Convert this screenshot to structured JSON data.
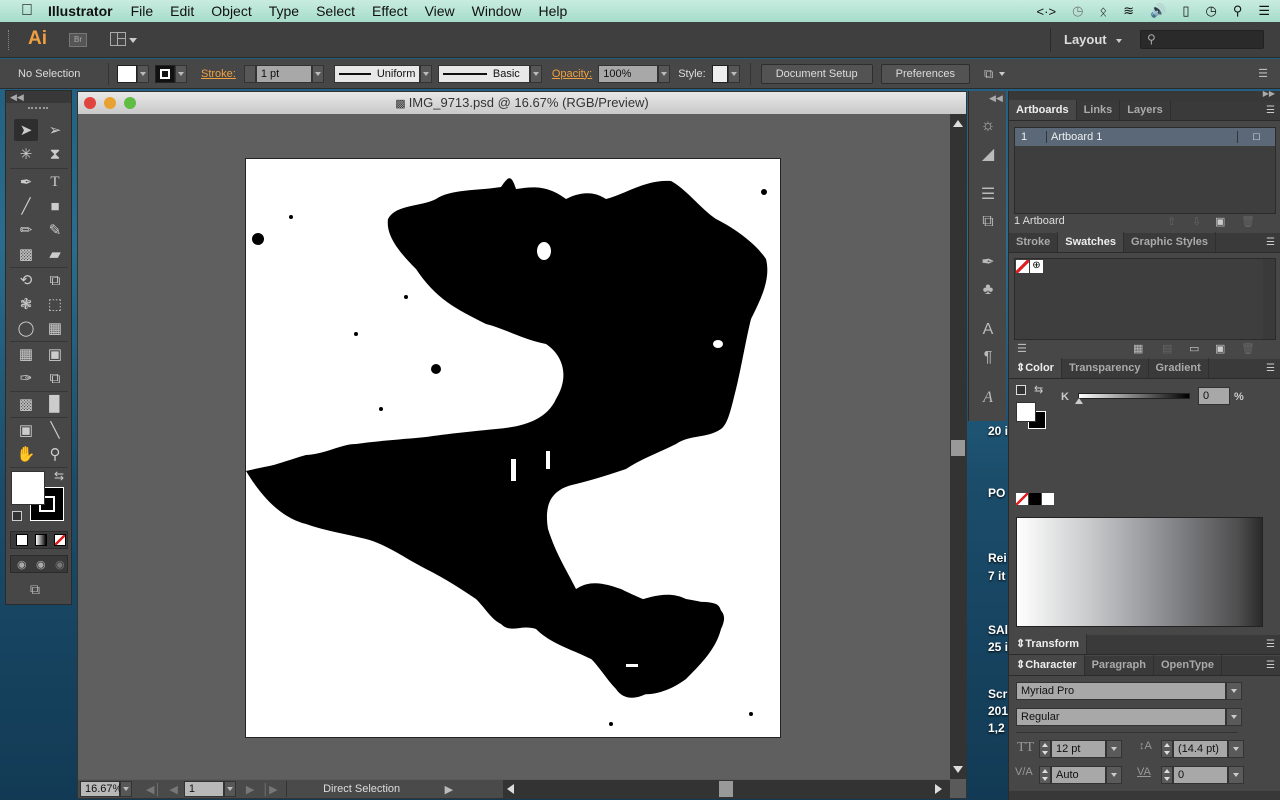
{
  "menubar": {
    "app_name": "Illustrator",
    "items": [
      "File",
      "Edit",
      "Object",
      "Type",
      "Select",
      "Effect",
      "View",
      "Window",
      "Help"
    ],
    "tray_icons": [
      "code-icon",
      "time-machine-icon",
      "bluetooth-icon",
      "wifi-icon",
      "volume-icon",
      "battery-icon",
      "clock-icon",
      "spotlight-icon",
      "notification-icon"
    ]
  },
  "appbar": {
    "logo": "Ai",
    "bridge_label": "Br",
    "workspace": "Layout",
    "search_placeholder": ""
  },
  "control_bar": {
    "selection_status": "No Selection",
    "stroke_label": "Stroke:",
    "stroke_weight": "1 pt",
    "stroke_profile": "Uniform",
    "brush": "Basic",
    "opacity_label": "Opacity:",
    "opacity": "100%",
    "style_label": "Style:",
    "document_setup": "Document Setup",
    "preferences": "Preferences"
  },
  "document": {
    "title": "IMG_9713.psd @ 16.67% (RGB/Preview)",
    "zoom": "16.67%",
    "artboard_number": "1",
    "current_tool": "Direct Selection"
  },
  "panels": {
    "artboards_group": {
      "tabs": [
        "Artboards",
        "Links",
        "Layers"
      ],
      "active": "Artboards",
      "rows": [
        {
          "index": "1",
          "name": "Artboard 1"
        }
      ],
      "footer": "1 Artboard"
    },
    "swatches_group": {
      "tabs": [
        "Stroke",
        "Swatches",
        "Graphic Styles"
      ],
      "active": "Swatches"
    },
    "color_group": {
      "tabs": [
        "Color",
        "Transparency",
        "Gradient"
      ],
      "active": "Color",
      "channel_label": "K",
      "channel_value": "0",
      "unit": "%"
    },
    "transform": {
      "title": "Transform"
    },
    "character_group": {
      "tabs": [
        "Character",
        "Paragraph",
        "OpenType"
      ],
      "active": "Character",
      "font_family": "Myriad Pro",
      "font_style": "Regular",
      "font_size": "12 pt",
      "leading": "(14.4 pt)",
      "kerning": "Auto",
      "tracking": "0"
    }
  },
  "desktop": {
    "labels": [
      "20 i",
      "PO",
      "Rei",
      "7 it",
      "SAl",
      "25 i",
      "Scr",
      "201",
      "1,2"
    ]
  },
  "colors": {
    "accent_orange": "#f0a040",
    "panel_bg": "#474747",
    "selected_row": "#5a6878"
  }
}
